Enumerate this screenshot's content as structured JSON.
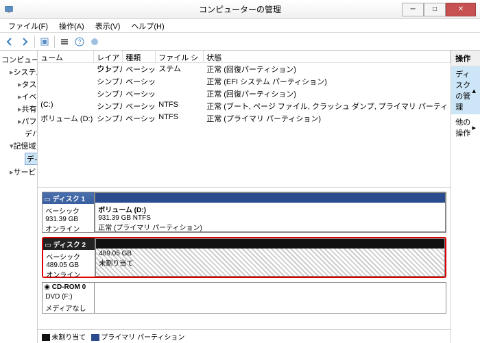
{
  "title": "コンピューターの管理",
  "menu": {
    "file": "ファイル(F)",
    "action": "操作(A)",
    "view": "表示(V)",
    "help": "ヘルプ(H)"
  },
  "tree": {
    "root": "コンピューターの管理 (ローカル)",
    "system": "システム ツール",
    "task": "タスク スケジューラ",
    "event": "イベント ビューアー",
    "shared": "共有フォルダー",
    "perf": "パフォーマンス",
    "device": "デバイス マネージャー",
    "storage": "記憶域",
    "disk": "ディスクの管理",
    "services": "サービスとアプリケーション"
  },
  "cols": {
    "volume": "ューム",
    "layout": "レイアウト",
    "type": "種類",
    "fs": "ファイル システム",
    "status": "状態"
  },
  "vols": [
    {
      "v": "",
      "l": "シンプル",
      "t": "ベーシック",
      "f": "",
      "s": "正常 (回復パーティション)"
    },
    {
      "v": "",
      "l": "シンプル",
      "t": "ベーシック",
      "f": "",
      "s": "正常 (EFI システム パーティション)"
    },
    {
      "v": "",
      "l": "シンプル",
      "t": "ベーシック",
      "f": "",
      "s": "正常 (回復パーティション)"
    },
    {
      "v": "(C:)",
      "l": "シンプル",
      "t": "ベーシック",
      "f": "NTFS",
      "s": "正常 (ブート, ページ ファイル, クラッシュ ダンプ, プライマリ パーティ"
    },
    {
      "v": "ボリューム (D:)",
      "l": "シンプル",
      "t": "ベーシック",
      "f": "NTFS",
      "s": "正常 (プライマリ パーティション)"
    }
  ],
  "disk1": {
    "title": "ディスク 1",
    "type": "ベーシック",
    "size": "931.39 GB",
    "status": "オンライン",
    "part": {
      "name": "ボリューム  (D:)",
      "size": "931.39 GB NTFS",
      "status": "正常 (プライマリ パーティション)"
    }
  },
  "disk2": {
    "title": "ディスク 2",
    "type": "ベーシック",
    "size": "489.05 GB",
    "status": "オンライン",
    "part": {
      "size": "489.05 GB",
      "status": "未割り当て"
    }
  },
  "cdrom": {
    "title": "CD-ROM 0",
    "sub": "DVD (F:)",
    "status": "メディアなし"
  },
  "legend": {
    "unalloc": "未割り当て",
    "primary": "プライマリ パーティション"
  },
  "actions": {
    "title": "操作",
    "disk": "ディスクの管理",
    "other": "他の操作"
  }
}
